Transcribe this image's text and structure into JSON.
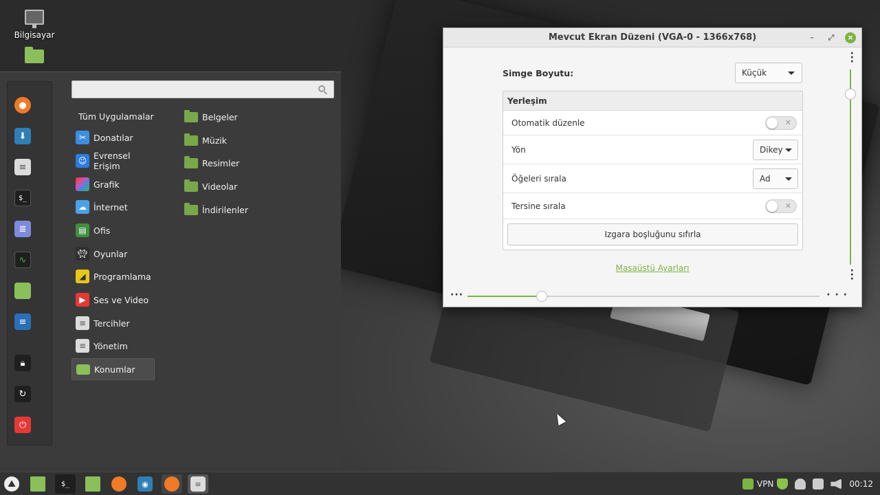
{
  "desktop": {
    "icons": [
      {
        "label": "Bilgisayar",
        "icon": "computer-icon"
      },
      {
        "label": "",
        "icon": "folder-icon"
      }
    ]
  },
  "menu": {
    "search_placeholder": "",
    "categories": [
      {
        "label": "Tüm Uygulamalar",
        "icon": ""
      },
      {
        "label": "Donatılar",
        "icon": "accessories-icon",
        "color": "#3d8ee0"
      },
      {
        "label": "Evrensel Erişim",
        "icon": "accessibility-icon",
        "color": "#2b7de0"
      },
      {
        "label": "Grafik",
        "icon": "graphics-icon",
        "color": "#d94fa5"
      },
      {
        "label": "İnternet",
        "icon": "internet-icon",
        "color": "#4aa3e8"
      },
      {
        "label": "Ofis",
        "icon": "office-icon",
        "color": "#3f8f3f"
      },
      {
        "label": "Oyunlar",
        "icon": "games-icon",
        "color": "#2f2f2f"
      },
      {
        "label": "Programlama",
        "icon": "programming-icon",
        "color": "#e5c619"
      },
      {
        "label": "Ses ve Video",
        "icon": "sound-video-icon",
        "color": "#e53935"
      },
      {
        "label": "Tercihler",
        "icon": "preferences-icon",
        "color": "#dcdcdc"
      },
      {
        "label": "Yönetim",
        "icon": "administration-icon",
        "color": "#dcdcdc"
      },
      {
        "label": "Konumlar",
        "icon": "places-icon",
        "color": "#8bbf5a"
      }
    ],
    "places": [
      {
        "label": "Belgeler"
      },
      {
        "label": "Müzik"
      },
      {
        "label": "Resimler"
      },
      {
        "label": "Videolar"
      },
      {
        "label": "İndirilenler"
      }
    ],
    "favorites": [
      {
        "name": "firefox-icon",
        "color": "#f07a28"
      },
      {
        "name": "software-manager-icon",
        "color": "#2f7fb5"
      },
      {
        "name": "settings-icon",
        "color": "#dcdcdc"
      },
      {
        "name": "terminal-icon",
        "color": "#2a2a2a"
      },
      {
        "name": "text-editor-icon",
        "color": "#7e8bdc"
      },
      {
        "name": "system-monitor-icon",
        "color": "#2a2a2a"
      },
      {
        "name": "files-icon",
        "color": "#8bbf5a"
      },
      {
        "name": "notes-icon",
        "color": "#2b6fb8"
      },
      {
        "name": "lock-icon",
        "color": "#2a2a2a"
      },
      {
        "name": "logout-icon",
        "color": "#2a2a2a"
      },
      {
        "name": "power-icon",
        "color": "#e53935"
      }
    ]
  },
  "dialog": {
    "title": "Mevcut Ekran Düzeni (VGA-0 - 1366x768)",
    "icon_size_label": "Simge Boyutu:",
    "icon_size_value": "Küçük",
    "section_title": "Yerleşim",
    "rows": {
      "auto_arrange": "Otomatik düzenle",
      "direction": "Yön",
      "direction_value": "Dikey",
      "sort_items": "Öğeleri sırala",
      "sort_value": "Ad",
      "reverse_sort": "Tersine sırala"
    },
    "reset_button": "Izgara boşluğunu sıfırla",
    "desktop_settings_link": "Masaüstü Ayarları",
    "toggles": {
      "auto_arrange": false,
      "reverse_sort": false
    }
  },
  "taskbar": {
    "apps": [
      {
        "name": "menu-icon"
      },
      {
        "name": "show-desktop-icon"
      },
      {
        "name": "terminal-icon"
      },
      {
        "name": "files-icon"
      },
      {
        "name": "firefox-icon"
      },
      {
        "name": "screenshot-icon"
      },
      {
        "name": "firefox-icon"
      },
      {
        "name": "settings-icon"
      }
    ],
    "vpn_label": "VPN",
    "clock": "00:12"
  },
  "colors": {
    "accent": "#7cb342",
    "menu_bg": "#3b3b3b",
    "panel_bg": "#323232"
  }
}
